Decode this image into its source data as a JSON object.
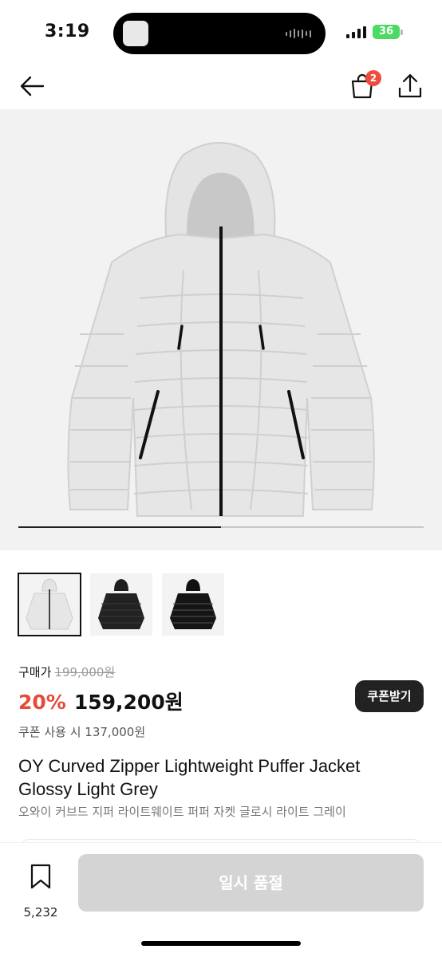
{
  "status_bar": {
    "time": "3:19",
    "battery": "36",
    "battery_color": "#4cd964"
  },
  "nav": {
    "back_icon": "arrow-left-icon",
    "bag_icon": "shopping-bag-icon",
    "bag_badge": "2",
    "share_icon": "share-icon"
  },
  "gallery": {
    "main_image": "light-grey-puffer-jacket",
    "progress": 0.5,
    "thumbnails": [
      {
        "color": "light grey",
        "selected": true
      },
      {
        "color": "black matte",
        "selected": false
      },
      {
        "color": "black glossy",
        "selected": false
      }
    ]
  },
  "price": {
    "label": "구매가",
    "original": "199,000원",
    "discount": "20%",
    "sale": "159,200원",
    "coupon_price": "쿠폰 사용 시 137,000원",
    "coupon_button": "쿠폰받기",
    "discount_color": "#e64a3a"
  },
  "product": {
    "title_line1": "OY Curved Zipper Lightweight Puffer Jacket",
    "title_line2": "Glossy Light Grey",
    "subtitle": "오와이 커브드 지퍼 라이트웨이트 퍼퍼 자켓 글로시 라이트 그레이"
  },
  "bottom": {
    "wish_icon": "bookmark-icon",
    "wish_count": "5,232",
    "soldout_label": "일시 품절"
  }
}
